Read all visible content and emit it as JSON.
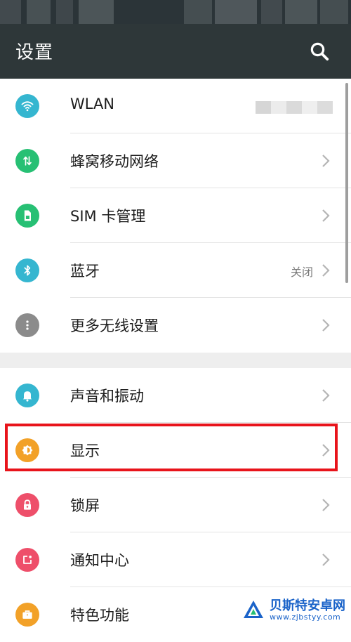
{
  "header": {
    "title": "设置",
    "search_icon": "search-icon"
  },
  "items": [
    {
      "label": "WLAN",
      "icon": "wifi-icon",
      "color": "#35b6d0",
      "value": ""
    },
    {
      "label": "蜂窝移动网络",
      "icon": "mobile-data-icon",
      "color": "#27c074",
      "value": ""
    },
    {
      "label": "SIM 卡管理",
      "icon": "sim-card-icon",
      "color": "#27c074",
      "value": ""
    },
    {
      "label": "蓝牙",
      "icon": "bluetooth-icon",
      "color": "#35b6d0",
      "value": "关闭"
    },
    {
      "label": "更多无线设置",
      "icon": "more-icon",
      "color": "#8b8b8b",
      "value": ""
    },
    {
      "label": "声音和振动",
      "icon": "bell-icon",
      "color": "#35b6d0",
      "value": ""
    },
    {
      "label": "显示",
      "icon": "brightness-icon",
      "color": "#f2a128",
      "value": ""
    },
    {
      "label": "锁屏",
      "icon": "lock-icon",
      "color": "#ee4f6a",
      "value": ""
    },
    {
      "label": "通知中心",
      "icon": "notification-icon",
      "color": "#ee4f6a",
      "value": ""
    },
    {
      "label": "特色功能",
      "icon": "briefcase-icon",
      "color": "#f2a128",
      "value": ""
    }
  ],
  "watermark": {
    "text": "贝斯特安卓网",
    "url": "www.zjbstyy.com"
  },
  "colors": {
    "appbar": "#2e3739",
    "highlight": "#e8141b"
  }
}
